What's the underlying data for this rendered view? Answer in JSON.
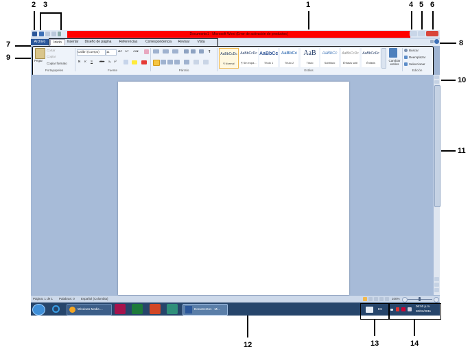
{
  "callouts": [
    "1",
    "2",
    "3",
    "4",
    "5",
    "6",
    "7",
    "8",
    "9",
    "10",
    "11",
    "12",
    "13",
    "14"
  ],
  "window": {
    "title": "Documento1  -  Microsoft Word (Error de activación de productos)"
  },
  "tabs": [
    "Archivo",
    "Inicio",
    "Insertar",
    "Diseño de página",
    "Referencias",
    "Correspondencia",
    "Revisar",
    "Vista"
  ],
  "ribbon": {
    "clipboard": {
      "paste": "Pegar",
      "cut": "Cortar",
      "copy": "Copiar",
      "format_painter": "Copiar formato",
      "group": "Portapapeles"
    },
    "font": {
      "name": "Calibri (Cuerpo)",
      "size": "11",
      "group": "Fuente",
      "bold": "N",
      "italic": "K",
      "underline": "S",
      "strike": "abc"
    },
    "paragraph": {
      "group": "Párrafo"
    },
    "styles": {
      "group": "Estilos",
      "items": [
        {
          "sample": "AaBbCcDc",
          "name": "¶ Normal"
        },
        {
          "sample": "AaBbCcDc",
          "name": "¶ Sin espa..."
        },
        {
          "sample": "AaBbCc",
          "name": "Título 1"
        },
        {
          "sample": "AaBbCc",
          "name": "Título 2"
        },
        {
          "sample": "AaB",
          "name": "Título"
        },
        {
          "sample": "AaBbCc",
          "name": "Subtítulo"
        },
        {
          "sample": "AaBbCcDc",
          "name": "Énfasis sutil"
        },
        {
          "sample": "AaBbCcDc",
          "name": "Énfasis"
        }
      ],
      "change": "Cambiar estilos"
    },
    "editing": {
      "find": "Buscar",
      "replace": "Reemplazar",
      "select": "Seleccionar",
      "group": "Edición"
    }
  },
  "statusbar": {
    "page": "Página: 1 de 1",
    "words": "Palabras: 0",
    "language": "Español (Colombia)",
    "zoom": "100%"
  },
  "taskbar": {
    "media": "Windows Media ...",
    "word": "Documento1 - Mi...",
    "lang": "ES",
    "time": "06:50 p.m.",
    "date": "30/01/2011"
  },
  "colors": {
    "title_highlight": "#ff0000",
    "ribbon": "#eef3fa",
    "taskbar": "#26456b",
    "doc_background": "#a7bbd8",
    "file_tab": "#2b579a"
  }
}
